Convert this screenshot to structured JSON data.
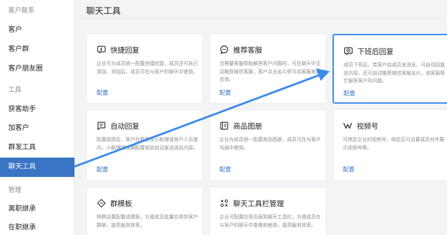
{
  "sidebar": {
    "rows": [
      {
        "label": "客户联系",
        "kind": "group"
      },
      {
        "label": "客户",
        "kind": "item"
      },
      {
        "label": "客户群",
        "kind": "item"
      },
      {
        "label": "客户朋友圈",
        "kind": "item"
      },
      {
        "label": "工具",
        "kind": "group"
      },
      {
        "label": "获客助手",
        "kind": "item"
      },
      {
        "label": "加客户",
        "kind": "item"
      },
      {
        "label": "群发工具",
        "kind": "item"
      },
      {
        "label": "聊天工具",
        "kind": "item",
        "active": true
      },
      {
        "label": "管理",
        "kind": "group"
      },
      {
        "label": "离职继承",
        "kind": "item"
      },
      {
        "label": "在职继承",
        "kind": "item"
      }
    ]
  },
  "main": {
    "title": "聊天工具",
    "cards": [
      {
        "name": "quick-reply",
        "icon": "quick-reply-icon",
        "title": "快捷回复",
        "desc": "企业可为成员统一配置快捷回复，成员还可自己添加、添加后，成员可在与客户的聊天中使用。",
        "link": "配置"
      },
      {
        "name": "recommend-service",
        "icon": "chat-bubble-icon",
        "title": "推荐客服",
        "desc": "当需要客服帮助解答客户问题时，可在聊天中主动推荐微信客服，客户点击名片即可向客服发起咨询。",
        "link": "配置"
      },
      {
        "name": "after-hours-reply",
        "icon": "clock-chat-icon",
        "title": "下班后回复",
        "desc": "成员下班后，若客户给成员发消息，可自动回复该内容，还可自动推荐微信客服名片，由客服帮忙解答客户的问题。",
        "link": "配置",
        "selected": true
      },
      {
        "name": "auto-reply",
        "icon": "auto-reply-icon",
        "title": "自动回复",
        "desc": "配置规则后，客户在群里@小助理或客户人员提问，小助理将根据配置规则自动发送消息内容。",
        "link": "配置"
      },
      {
        "name": "product-album",
        "icon": "album-icon",
        "title": "商品图册",
        "desc": "企业为成员统一配置商品图册，成员可在与客户沟通中使用。",
        "link": "配置"
      },
      {
        "name": "channels",
        "icon": "channels-icon",
        "title": "视频号",
        "desc": "可绑定企业的视频号，绑定后可设置成员对外展示视频号等。",
        "link": "配置"
      },
      {
        "name": "group-template",
        "icon": "diamond-template-icon",
        "title": "群模板",
        "desc": "将群设置配置成模板，方便成员批量应用到客户群聊，提高服务效率。",
        "link": ""
      },
      {
        "name": "toolbar-manage",
        "icon": "toolbar-grid-icon",
        "title": "聊天工具栏管理",
        "desc": "企业可配置应用页面到聊天工具栏，方便成员在与客户的聊天中查看和使用，提高服务效率。",
        "link": ""
      }
    ]
  },
  "colors": {
    "accent": "#3a74c4",
    "selected_border": "#3d8be8",
    "arrow": "#3d8be8"
  }
}
